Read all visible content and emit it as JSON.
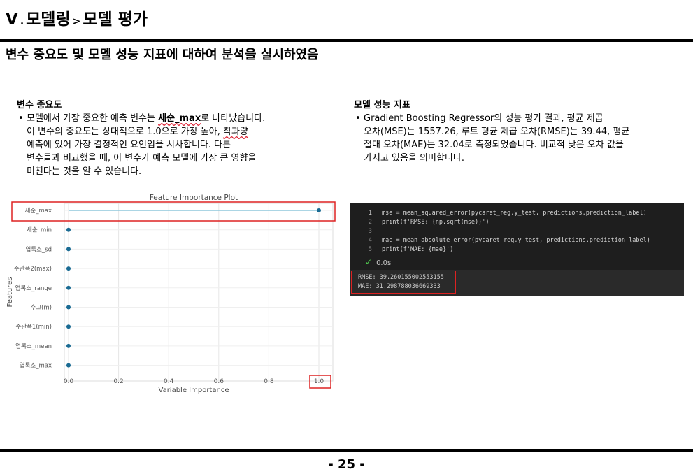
{
  "header": {
    "chapter": "Ⅴ",
    "dot": ".",
    "section": "모델링",
    "arrow": ">",
    "page_title": "모델 평가"
  },
  "subtitle": "변수 중요도 및 모델 성능 지표에 대하여 분석을 실시하였음",
  "left": {
    "heading": "변수 중요도",
    "text_a": "모델에서 가장 중요한 예측 변수는 ",
    "text_bold": "새순_max",
    "text_b": "로 나타났습니다.",
    "text_c": "이 변수의 중요도는 상대적으로 1.0으로 가장 높아, ",
    "text_d": "착과량",
    "text_e": "예측에 있어 가장 결정적인 요인임을 시사합니다. 다른",
    "text_f": "변수들과 비교했을 때, 이 변수가 예측 모델에 가장 큰 영향을",
    "text_g": "미친다는 것을 알 수 있습니다."
  },
  "right": {
    "heading": "모델 성능 지표",
    "text_a": "Gradient Boosting Regressor의 성능 평가 결과, 평균 제곱",
    "text_b": "오차(MSE)는 1557.26, 루트 평균 제곱 오차(RMSE)는 39.44, 평균",
    "text_c": "절대 오차(MAE)는 32.04로 측정되었습니다. 비교적 낮은 오차 값을",
    "text_d": "가지고 있음을 의미합니다."
  },
  "chart_data": {
    "type": "scatter",
    "title": "Feature Importance Plot",
    "xlabel": "Variable Importance",
    "ylabel": "Features",
    "categories": [
      "새순_max",
      "새순_min",
      "엽록소_sd",
      "수관폭2(max)",
      "엽록소_range",
      "수고(m)",
      "수관폭1(min)",
      "엽록소_mean",
      "엽록소_max"
    ],
    "values": [
      1.0,
      0.0,
      0.0,
      0.0,
      0.0,
      0.0,
      0.0,
      0.0,
      0.0
    ],
    "xticks": [
      "0.0",
      "0.2",
      "0.4",
      "0.6",
      "0.8",
      "1.0"
    ],
    "xlim": [
      0,
      1
    ],
    "grid": true,
    "colors": {
      "point": "#1a6b93",
      "line": "#8fc7dc",
      "highlight": "#dd2222"
    }
  },
  "code": {
    "lines": [
      {
        "num": "1",
        "text": "mse = mean_squared_error(pycaret_reg.y_test, predictions.prediction_label)"
      },
      {
        "num": "2",
        "text": "print(f'RMSE: {np.sqrt(mse)}')"
      },
      {
        "num": "3",
        "text": ""
      },
      {
        "num": "4",
        "text": "mae = mean_absolute_error(pycaret_reg.y_test, predictions.prediction_label)"
      },
      {
        "num": "5",
        "text": "print(f'MAE: {mae}')"
      }
    ],
    "status_check": "✓",
    "status_time": "0.0s",
    "output": [
      "RMSE: 39.260155002553155",
      "MAE: 31.298788036669333"
    ]
  },
  "footer": {
    "page": "- 25 -"
  }
}
